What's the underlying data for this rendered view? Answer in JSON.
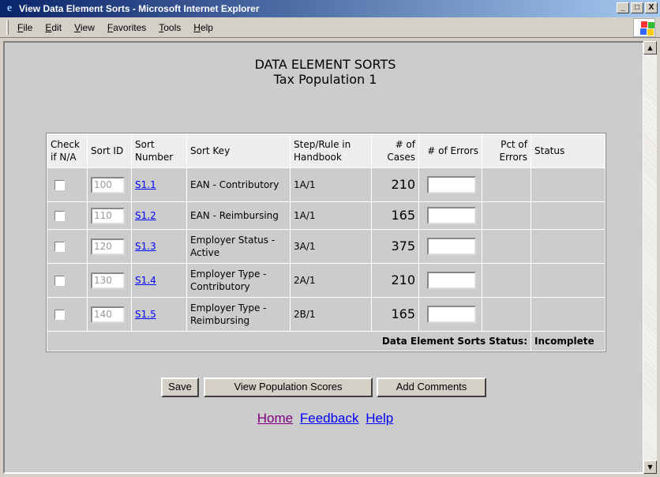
{
  "window": {
    "title": "View Data Element Sorts - Microsoft Internet Explorer",
    "minimize": "_",
    "maximize": "□",
    "close": "X"
  },
  "menu": [
    "File",
    "Edit",
    "View",
    "Favorites",
    "Tools",
    "Help"
  ],
  "page": {
    "title": "DATA ELEMENT SORTS",
    "subtitle": "Tax Population 1"
  },
  "table": {
    "headers": [
      "Check if N/A",
      "Sort ID",
      "Sort Number",
      "Sort Key",
      "Step/Rule in Handbook",
      "# of Cases",
      "# of Errors",
      "Pct of Errors",
      "Status"
    ],
    "rows": [
      {
        "sort_id": "100",
        "sort_number": "S1.1",
        "sort_key": "EAN - Contributory",
        "step_rule": "1A/1",
        "cases": "210",
        "errors": "",
        "pct": "",
        "status": ""
      },
      {
        "sort_id": "110",
        "sort_number": "S1.2",
        "sort_key": "EAN - Reimbursing",
        "step_rule": "1A/1",
        "cases": "165",
        "errors": "",
        "pct": "",
        "status": ""
      },
      {
        "sort_id": "120",
        "sort_number": "S1.3",
        "sort_key": "Employer Status - Active",
        "step_rule": "3A/1",
        "cases": "375",
        "errors": "",
        "pct": "",
        "status": ""
      },
      {
        "sort_id": "130",
        "sort_number": "S1.4",
        "sort_key": "Employer Type - Contributory",
        "step_rule": "2A/1",
        "cases": "210",
        "errors": "",
        "pct": "",
        "status": ""
      },
      {
        "sort_id": "140",
        "sort_number": "S1.5",
        "sort_key": "Employer Type - Reimbursing",
        "step_rule": "2B/1",
        "cases": "165",
        "errors": "",
        "pct": "",
        "status": ""
      }
    ],
    "footer_label": "Data Element Sorts Status:",
    "footer_status": "Incomplete"
  },
  "buttons": {
    "save": "Save",
    "view_scores": "View Population Scores",
    "add_comments": "Add Comments"
  },
  "links": {
    "home": "Home",
    "feedback": "Feedback",
    "help": "Help",
    "visited_color": "#800080",
    "link_color": "#0000ff"
  }
}
